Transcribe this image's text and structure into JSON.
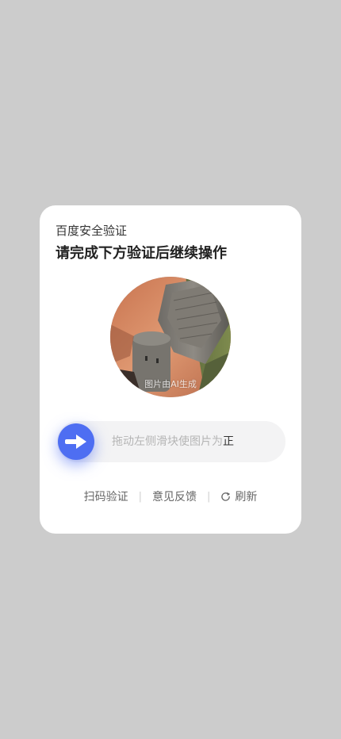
{
  "header": {
    "brand": "百度安全验证",
    "title": "请完成下方验证后继续操作"
  },
  "puzzle": {
    "ai_note": "图片由AI生成"
  },
  "slider": {
    "hint_prefix": "拖动左侧滑块使图片为",
    "hint_emphasis": "正",
    "knob_icon": "arrow-right-icon",
    "accent_color": "#4e6ef2"
  },
  "footer": {
    "qr_verify": "扫码验证",
    "separator": "|",
    "feedback": "意见反馈",
    "refresh_icon": "refresh-icon",
    "refresh": "刷新"
  }
}
